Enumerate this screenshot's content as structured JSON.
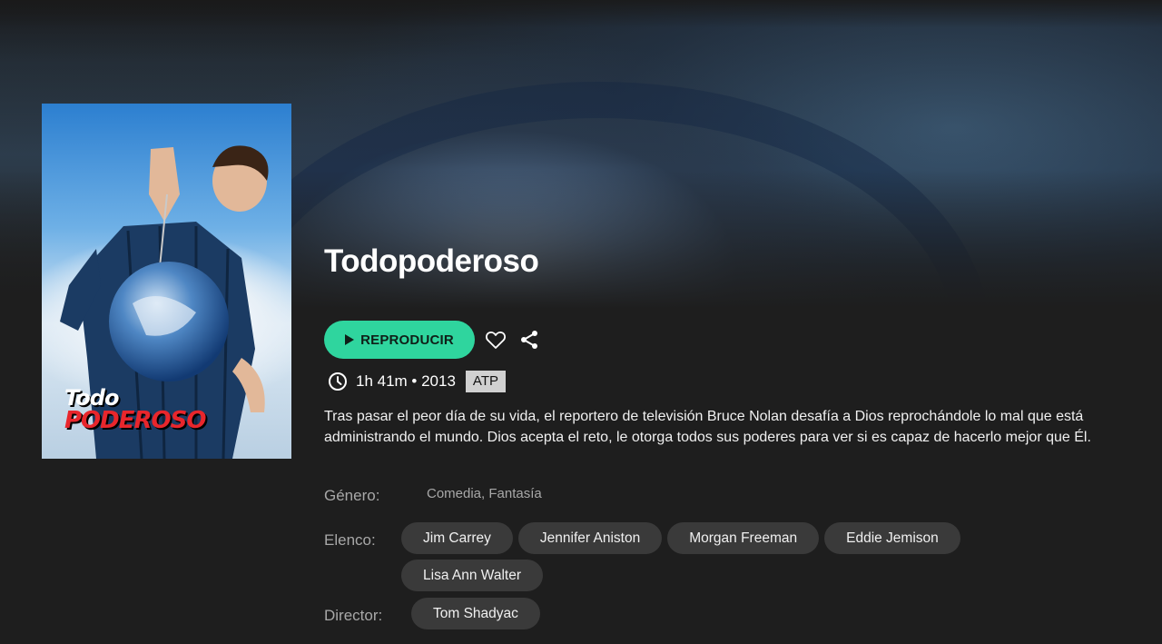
{
  "movie": {
    "title": "Todopoderoso",
    "poster": {
      "title_line1": "Todo",
      "title_line2": "PODEROSO"
    },
    "play_label": "REPRODUCIR",
    "duration_year": "1h 41m • 2013",
    "rating": "ATP",
    "description": "Tras pasar el peor día de su vida, el reportero de televisión Bruce Nolan desafía a Dios reprochándole lo mal que está administrando el mundo. Dios acepta el reto, le otorga todos sus poderes para ver si es capaz de hacerlo mejor que Él.",
    "genre_label": "Género:",
    "genres": "Comedia, Fantasía",
    "cast_label": "Elenco:",
    "cast": [
      "Jim Carrey",
      "Jennifer Aniston",
      "Morgan Freeman",
      "Eddie Jemison",
      "Lisa Ann Walter"
    ],
    "director_label": "Director:",
    "directors": [
      "Tom Shadyac"
    ]
  },
  "icons": {
    "play": "play-icon",
    "favorite": "heart-icon",
    "share": "share-icon",
    "duration": "clock-icon"
  },
  "colors": {
    "accent": "#2fd59e",
    "background": "#1e1e1e",
    "chip": "#3a3a3a",
    "badge": "#d0d0d0"
  }
}
